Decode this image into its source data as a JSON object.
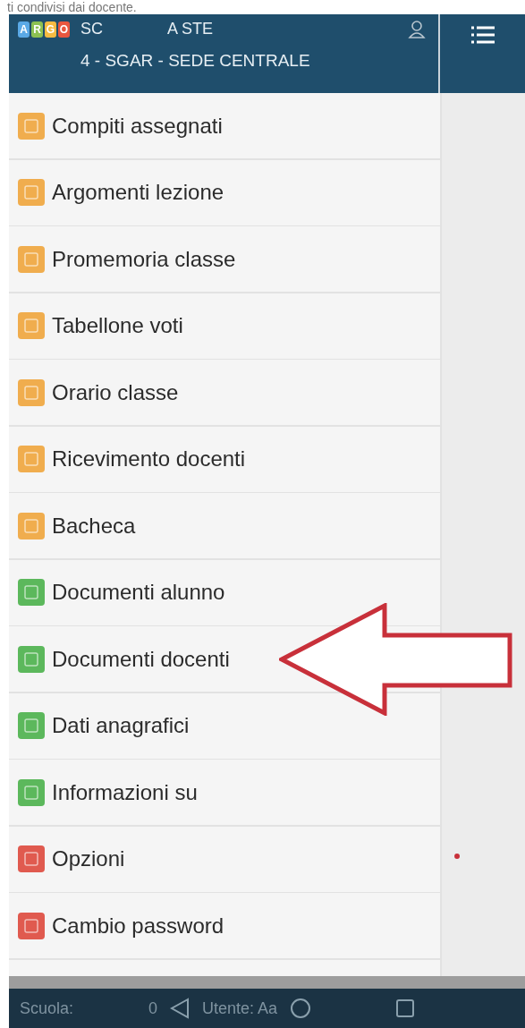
{
  "caption": "ti condivisi dai docente.",
  "header": {
    "logo": [
      {
        "letter": "A",
        "color": "#5aa9e6"
      },
      {
        "letter": "R",
        "color": "#8cc152"
      },
      {
        "letter": "G",
        "color": "#f6bb42"
      },
      {
        "letter": "O",
        "color": "#e9573f"
      }
    ],
    "title_parts": [
      "SC",
      "A STE"
    ],
    "subtitle": "4 - SGAR - SEDE CENTRALE"
  },
  "menu": [
    {
      "label": "Compiti assegnati",
      "color": "#f0ad4e"
    },
    {
      "label": "Argomenti lezione",
      "color": "#f0ad4e"
    },
    {
      "label": "Promemoria classe",
      "color": "#f0ad4e"
    },
    {
      "label": "Tabellone voti",
      "color": "#f0ad4e"
    },
    {
      "label": "Orario classe",
      "color": "#f0ad4e"
    },
    {
      "label": "Ricevimento docenti",
      "color": "#f0ad4e"
    },
    {
      "label": "Bacheca",
      "color": "#f0ad4e"
    },
    {
      "label": "Documenti alunno",
      "color": "#5cb85c"
    },
    {
      "label": "Documenti docenti",
      "color": "#5cb85c"
    },
    {
      "label": "Dati anagrafici",
      "color": "#5cb85c"
    },
    {
      "label": "Informazioni su",
      "color": "#5cb85c"
    },
    {
      "label": "Opzioni",
      "color": "#e05a4f"
    },
    {
      "label": "Cambio password",
      "color": "#e05a4f"
    }
  ],
  "status_bar": {
    "school": "Scuola:",
    "school_code": "0",
    "user": "Utente: Aa"
  }
}
